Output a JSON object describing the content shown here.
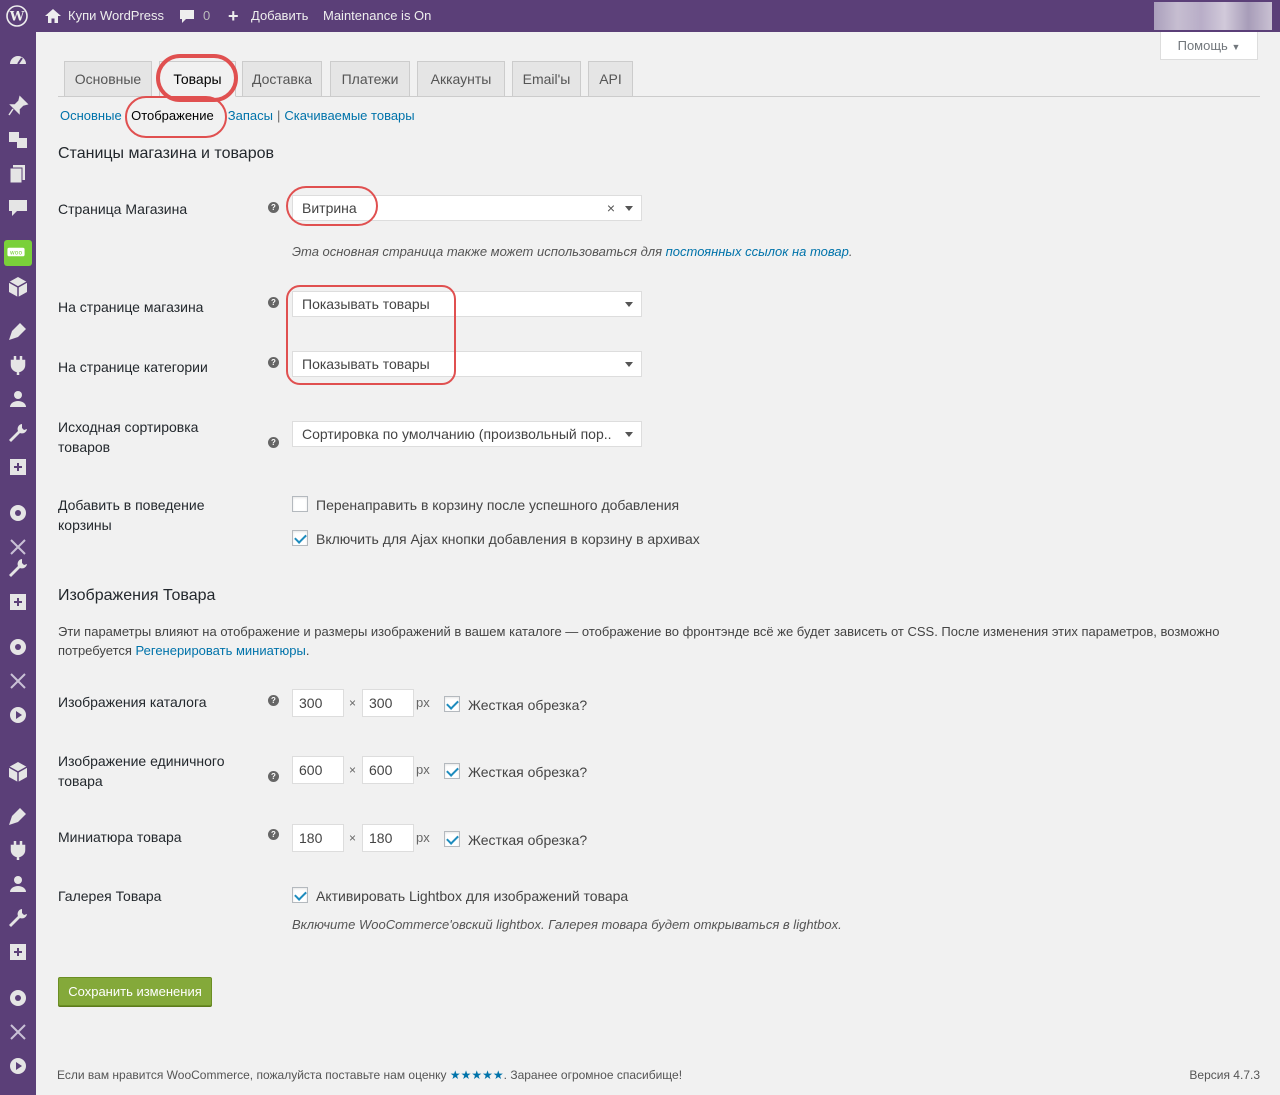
{
  "adminbar": {
    "site_name": "Купи WordPress",
    "comments_count": "0",
    "add_label": "Добавить",
    "maintenance": "Maintenance is On"
  },
  "help_label": "Помощь",
  "tabs": [
    {
      "label": "Основные"
    },
    {
      "label": "Товары"
    },
    {
      "label": "Доставка"
    },
    {
      "label": "Платежи"
    },
    {
      "label": "Аккаунты"
    },
    {
      "label": "Email'ы"
    },
    {
      "label": "API"
    }
  ],
  "subnav": {
    "main": "Основные",
    "display": "Отображение",
    "stock": "Запасы",
    "downloads": "Скачиваемые товары",
    "sep": "|"
  },
  "shop_section": {
    "title": "Станицы магазина и товаров",
    "shop_page_label": "Страница Магазина",
    "shop_page_value": "Витрина",
    "shop_page_desc": "Эта основная страница также может использоваться для ",
    "shop_page_link": "постоянных ссылок на товар",
    "shop_page_desc_end": ".",
    "shop_display_label": "На странице магазина",
    "shop_display_value": "Показывать товары",
    "category_display_label": "На странице категории",
    "category_display_value": "Показывать товары",
    "sorting_label": "Исходная сортировка товаров",
    "sorting_value": "Сортировка по умолчанию (произвольный пор..",
    "cart_label": "Добавить в поведение корзины",
    "cart_redirect": "Перенаправить в корзину после успешного добавления",
    "cart_ajax": "Включить для Ajax кнопки добавления в корзину в архивах"
  },
  "images_section": {
    "title": "Изображения Товара",
    "desc": "Эти параметры влияют на отображение и размеры изображений в вашем каталоге — отображение во фронтэнде всё же будет зависеть от CSS. После изменения этих параметров, возможно потребуется ",
    "desc_link": "Регенерировать миниатюры",
    "desc_end": ".",
    "catalog_label": "Изображения каталога",
    "catalog_w": "300",
    "catalog_h": "300",
    "single_label": "Изображение единичного товара",
    "single_w": "600",
    "single_h": "600",
    "thumb_label": "Миниатюра товара",
    "thumb_w": "180",
    "thumb_h": "180",
    "px": "px",
    "times": "×",
    "hard_crop": "Жесткая обрезка?",
    "gallery_label": "Галерея Товара",
    "gallery_lightbox": "Активировать Lightbox для изображений товара",
    "gallery_desc": "Включите WooCommerce'овский lightbox. Галерея товара будет открываться в lightbox."
  },
  "save_label": "Сохранить изменения",
  "footer": {
    "text1": "Если вам нравится ",
    "brand": "WooCommerce",
    "text2": ", пожалуйста поставьте нам оценку ",
    "stars": "★★★★★",
    "text3": ". Заранее огромное спасибище!",
    "version": "Версия 4.7.3"
  },
  "colors": {
    "adminbar": "#5b3f78",
    "link": "#0073aa",
    "save": "#84a93a",
    "annotation": "#e05050"
  }
}
